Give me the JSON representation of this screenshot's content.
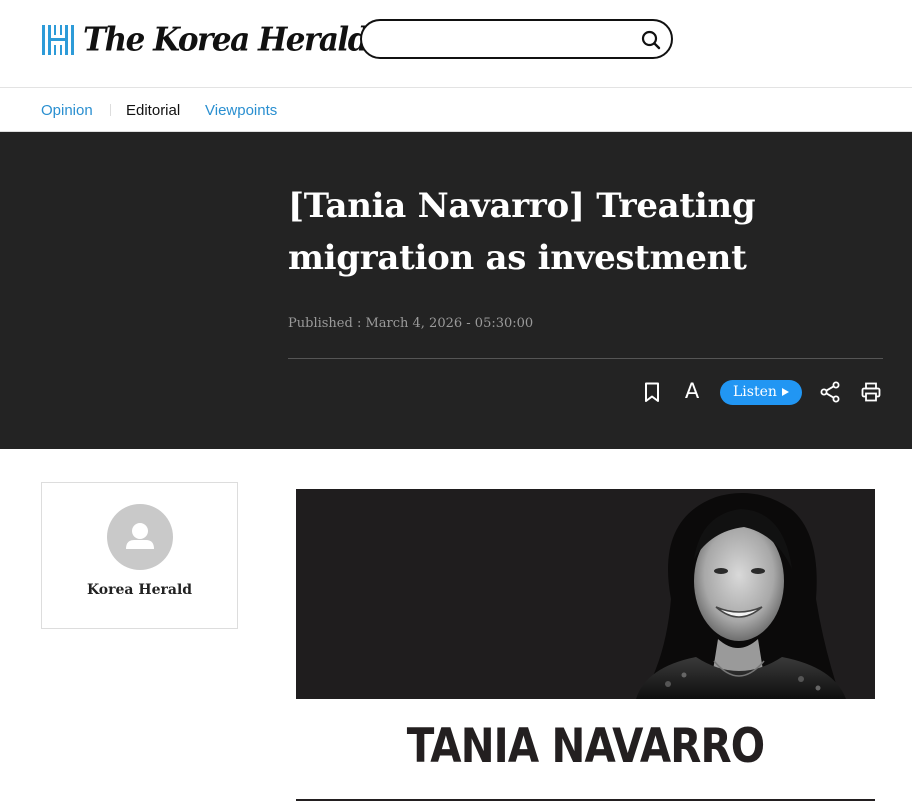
{
  "header": {
    "logo_text": "The Korea Herald",
    "search": {
      "value": "",
      "placeholder": ""
    }
  },
  "subnav": {
    "items": [
      {
        "label": "Opinion",
        "color": "#2a8fd0"
      },
      {
        "label": "Editorial",
        "color": "#111111"
      },
      {
        "label": "Viewpoints",
        "color": "#2a8fd0"
      }
    ]
  },
  "article": {
    "headline": "[Tania Navarro] Treating migration as investment",
    "published": "Published : March 4, 2026 - 05:30:00",
    "tools": {
      "bookmark_icon": "bookmark-icon",
      "font_size_label": "A",
      "listen_label": "Listen",
      "share_icon": "share-icon",
      "print_icon": "print-icon"
    },
    "author": {
      "name": "Korea Herald"
    },
    "photo": {
      "name_caption": "TANIA NAVARRO"
    }
  },
  "colors": {
    "accent": "#2196f3",
    "link": "#2a8fd0",
    "band": "#232323"
  }
}
